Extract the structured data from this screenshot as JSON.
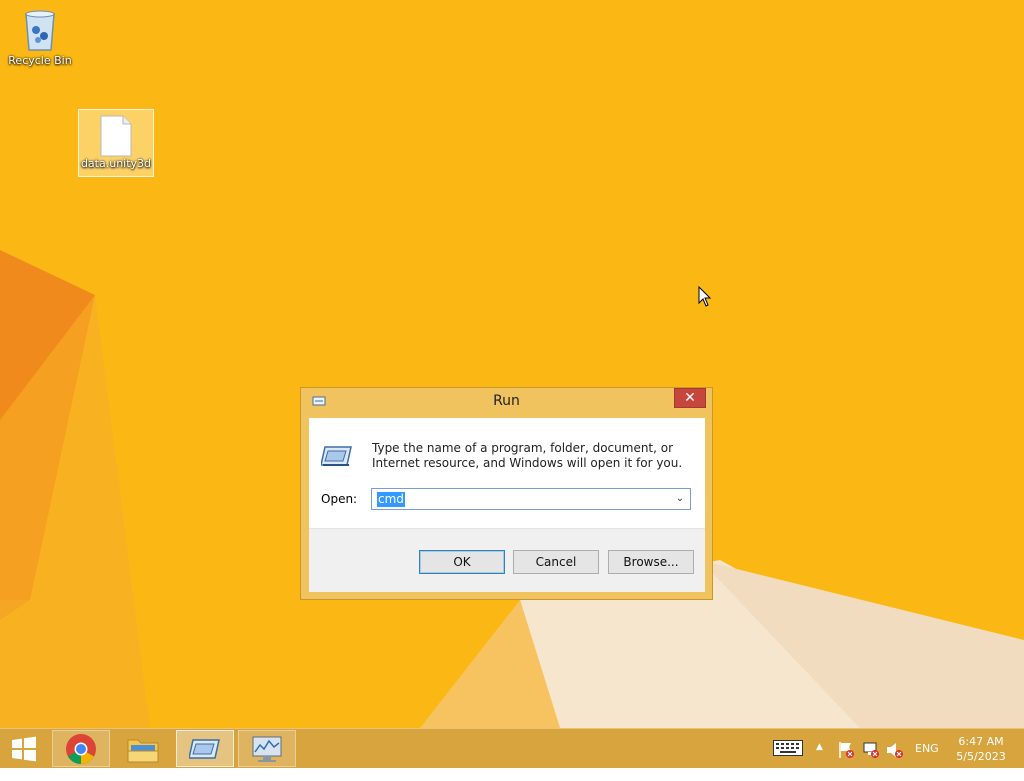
{
  "desktop": {
    "icons": [
      {
        "label": "Recycle Bin",
        "icon": "recycle-bin-icon"
      },
      {
        "label": "data.unity3d",
        "icon": "blank-file-icon"
      }
    ]
  },
  "run_dialog": {
    "title": "Run",
    "close_glyph": "✕",
    "description": "Type the name of a program, folder, document, or Internet resource, and Windows will open it for you.",
    "open_label": "Open:",
    "open_value": "cmd",
    "buttons": {
      "ok": "OK",
      "cancel": "Cancel",
      "browse": "Browse..."
    }
  },
  "taskbar": {
    "pinned": [
      {
        "name": "start",
        "icon": "windows-logo-icon"
      },
      {
        "name": "chrome",
        "icon": "chrome-icon"
      },
      {
        "name": "file-explorer",
        "icon": "folder-icon"
      },
      {
        "name": "run",
        "icon": "run-icon"
      },
      {
        "name": "resource-monitor",
        "icon": "monitor-icon"
      }
    ],
    "tray": {
      "show_hidden_glyph": "▲",
      "language": "ENG",
      "time": "6:47 AM",
      "date": "5/5/2023"
    }
  },
  "colors": {
    "wallpaper": "#fbb814",
    "wallpaper_shape_orange": "#f08a1c",
    "wallpaper_shape_light": "#f4e8d6",
    "taskbar": "#d7a43e",
    "dialog_frame": "#f1c35e",
    "close_button": "#c7463b",
    "selection": "#3399ff"
  }
}
